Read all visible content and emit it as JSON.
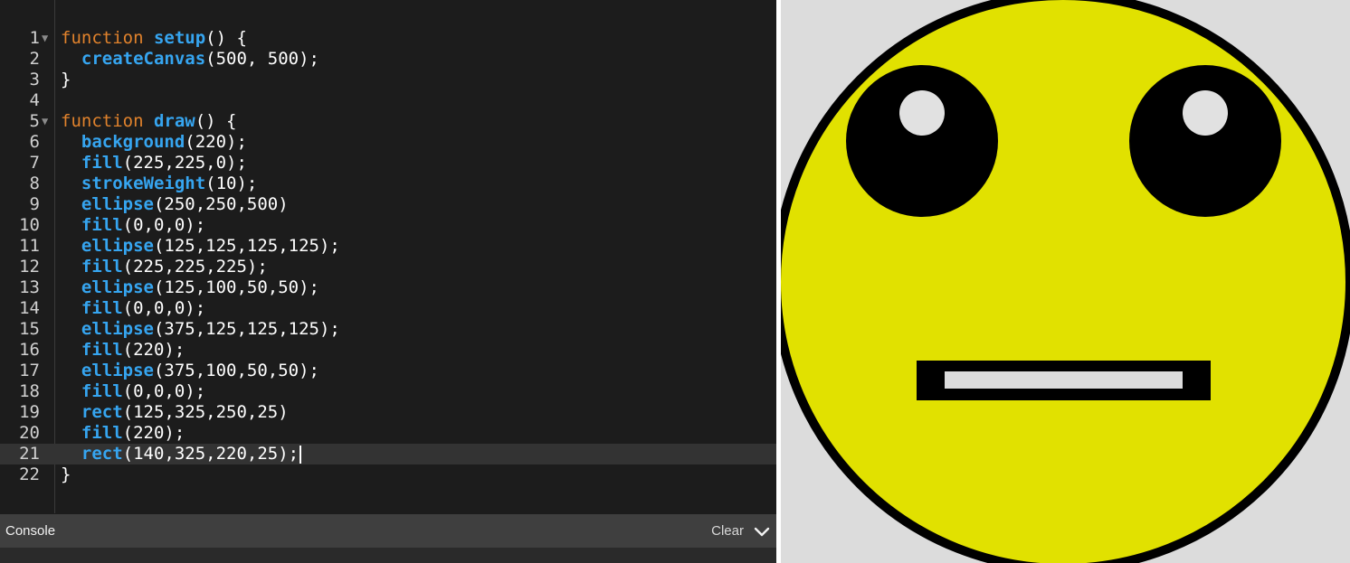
{
  "editor": {
    "lines": [
      {
        "num": "1",
        "fold": "▼",
        "tokens": [
          [
            "kw",
            "function "
          ],
          [
            "fn",
            "setup"
          ],
          [
            "plain",
            "() {"
          ]
        ]
      },
      {
        "num": "2",
        "fold": "",
        "tokens": [
          [
            "plain",
            "  "
          ],
          [
            "call",
            "createCanvas"
          ],
          [
            "plain",
            "(500, 500);"
          ]
        ]
      },
      {
        "num": "3",
        "fold": "",
        "tokens": [
          [
            "plain",
            "}"
          ]
        ]
      },
      {
        "num": "4",
        "fold": "",
        "tokens": []
      },
      {
        "num": "5",
        "fold": "▼",
        "tokens": [
          [
            "kw",
            "function "
          ],
          [
            "fn",
            "draw"
          ],
          [
            "plain",
            "() {"
          ]
        ]
      },
      {
        "num": "6",
        "fold": "",
        "tokens": [
          [
            "plain",
            "  "
          ],
          [
            "call",
            "background"
          ],
          [
            "plain",
            "(220);"
          ]
        ]
      },
      {
        "num": "7",
        "fold": "",
        "tokens": [
          [
            "plain",
            "  "
          ],
          [
            "call",
            "fill"
          ],
          [
            "plain",
            "(225,225,0);"
          ]
        ]
      },
      {
        "num": "8",
        "fold": "",
        "tokens": [
          [
            "plain",
            "  "
          ],
          [
            "call",
            "strokeWeight"
          ],
          [
            "plain",
            "(10);"
          ]
        ]
      },
      {
        "num": "9",
        "fold": "",
        "tokens": [
          [
            "plain",
            "  "
          ],
          [
            "call",
            "ellipse"
          ],
          [
            "plain",
            "(250,250,500)"
          ]
        ]
      },
      {
        "num": "10",
        "fold": "",
        "tokens": [
          [
            "plain",
            "  "
          ],
          [
            "call",
            "fill"
          ],
          [
            "plain",
            "(0,0,0);"
          ]
        ]
      },
      {
        "num": "11",
        "fold": "",
        "tokens": [
          [
            "plain",
            "  "
          ],
          [
            "call",
            "ellipse"
          ],
          [
            "plain",
            "(125,125,125,125);"
          ]
        ]
      },
      {
        "num": "12",
        "fold": "",
        "tokens": [
          [
            "plain",
            "  "
          ],
          [
            "call",
            "fill"
          ],
          [
            "plain",
            "(225,225,225);"
          ]
        ]
      },
      {
        "num": "13",
        "fold": "",
        "tokens": [
          [
            "plain",
            "  "
          ],
          [
            "call",
            "ellipse"
          ],
          [
            "plain",
            "(125,100,50,50);"
          ]
        ]
      },
      {
        "num": "14",
        "fold": "",
        "tokens": [
          [
            "plain",
            "  "
          ],
          [
            "call",
            "fill"
          ],
          [
            "plain",
            "(0,0,0);"
          ]
        ]
      },
      {
        "num": "15",
        "fold": "",
        "tokens": [
          [
            "plain",
            "  "
          ],
          [
            "call",
            "ellipse"
          ],
          [
            "plain",
            "(375,125,125,125);"
          ]
        ]
      },
      {
        "num": "16",
        "fold": "",
        "tokens": [
          [
            "plain",
            "  "
          ],
          [
            "call",
            "fill"
          ],
          [
            "plain",
            "(220);"
          ]
        ]
      },
      {
        "num": "17",
        "fold": "",
        "tokens": [
          [
            "plain",
            "  "
          ],
          [
            "call",
            "ellipse"
          ],
          [
            "plain",
            "(375,100,50,50);"
          ]
        ]
      },
      {
        "num": "18",
        "fold": "",
        "tokens": [
          [
            "plain",
            "  "
          ],
          [
            "call",
            "fill"
          ],
          [
            "plain",
            "(0,0,0);"
          ]
        ]
      },
      {
        "num": "19",
        "fold": "",
        "tokens": [
          [
            "plain",
            "  "
          ],
          [
            "call",
            "rect"
          ],
          [
            "plain",
            "(125,325,250,25)"
          ]
        ]
      },
      {
        "num": "20",
        "fold": "",
        "tokens": [
          [
            "plain",
            "  "
          ],
          [
            "call",
            "fill"
          ],
          [
            "plain",
            "(220);"
          ]
        ]
      },
      {
        "num": "21",
        "fold": "",
        "active": true,
        "tokens": [
          [
            "plain",
            "  "
          ],
          [
            "call",
            "rect"
          ],
          [
            "plain",
            "(140,325,220,25);"
          ]
        ]
      },
      {
        "num": "22",
        "fold": "",
        "tokens": [
          [
            "plain",
            "}"
          ]
        ]
      }
    ]
  },
  "console": {
    "title": "Console",
    "clear_label": "Clear",
    "toggle_icon": "chevron-down-icon"
  },
  "preview": {
    "background_color": "#dcdcdc",
    "face_color": "#e1e100",
    "outline_color": "#000000",
    "eye_color": "#000000",
    "pupil_color": "#e1e1e1",
    "mouth_outer_color": "#000000",
    "mouth_inner_color": "#dcdcdc"
  },
  "colors": {
    "keyword": "#e0822c",
    "function": "#36a5f0",
    "editor_bg": "#1c1c1c",
    "console_bar_bg": "#3f3f3f"
  }
}
